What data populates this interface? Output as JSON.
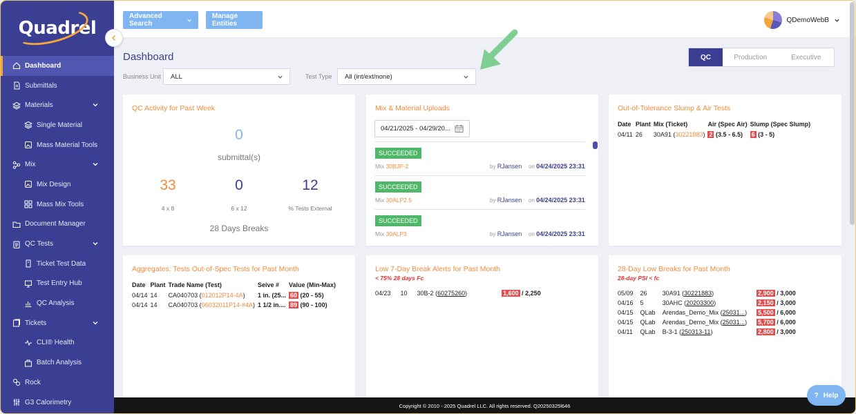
{
  "brand": {
    "logo_text": "Quadrel",
    "accent": "#f3a63a",
    "primary": "#3a3f94"
  },
  "sidebar": {
    "items": [
      {
        "label": "Dashboard",
        "icon": "home-icon",
        "active": true
      },
      {
        "label": "Submittals",
        "icon": "document-icon"
      },
      {
        "label": "Materials",
        "icon": "layers-icon",
        "expandable": true
      },
      {
        "label": "Single Material",
        "icon": "layers-icon",
        "sub": true
      },
      {
        "label": "Mass Material Tools",
        "icon": "image-icon",
        "sub": true
      },
      {
        "label": "Mix",
        "icon": "mix-icon",
        "expandable": true
      },
      {
        "label": "Mix Design",
        "icon": "image-icon",
        "sub": true
      },
      {
        "label": "Mass Mix Tools",
        "icon": "grid-icon",
        "sub": true
      },
      {
        "label": "Document Manager",
        "icon": "folder-icon"
      },
      {
        "label": "QC Tests",
        "icon": "clipboard-icon",
        "expandable": true
      },
      {
        "label": "Ticket Test Data",
        "icon": "ticket-icon",
        "sub": true
      },
      {
        "label": "Test Entry Hub",
        "icon": "monitor-icon",
        "sub": true
      },
      {
        "label": "QC Analysis",
        "icon": "chart-icon",
        "sub": true
      },
      {
        "label": "Tickets",
        "icon": "tickets-icon",
        "expandable": true
      },
      {
        "label": "CLI® Health",
        "icon": "health-icon",
        "sub": true
      },
      {
        "label": "Batch Analysis",
        "icon": "batch-icon",
        "sub": true
      },
      {
        "label": "Rock",
        "icon": "rock-icon"
      },
      {
        "label": "G3 Calorimetry",
        "icon": "sliders-icon"
      }
    ]
  },
  "topbar": {
    "advanced_search": "Advanced Search",
    "manage_entities": "Manage Entities",
    "username": "QDemoWebB"
  },
  "page": {
    "title": "Dashboard",
    "business_unit_label": "Business Unit",
    "business_unit_value": "ALL",
    "test_type_label": "Test Type",
    "test_type_value": "All (int/ext/none)",
    "views": [
      "QC",
      "Production",
      "Executive"
    ],
    "active_view": "QC"
  },
  "qc_activity": {
    "title": "QC Activity for Past Week",
    "submittals_count": "0",
    "submittals_label": "submittal(s)",
    "stats": [
      {
        "value": "33",
        "label": "4 x 8",
        "color": "#f28b3b"
      },
      {
        "value": "0",
        "label": "6 x 12",
        "color": "#3a3f94"
      },
      {
        "value": "12",
        "label": "% Tests External",
        "color": "#3a3f94"
      }
    ],
    "footer": "28 Days Breaks"
  },
  "uploads": {
    "title": "Mix & Material Uploads",
    "date_range": "04/21/2025 - 04/29/20...",
    "items": [
      {
        "status": "SUCCEEDED",
        "mix_prefix": "Mix",
        "mix": "30BJP-2",
        "by": "by",
        "user": "RJansen",
        "on": "on",
        "date": "04/24/2025 23:31"
      },
      {
        "status": "SUCCEEDED",
        "mix_prefix": "Mix",
        "mix": "30ALP2.5",
        "by": "by",
        "user": "RJansen",
        "on": "on",
        "date": "04/24/2025 23:31"
      },
      {
        "status": "SUCCEEDED",
        "mix_prefix": "Mix",
        "mix": "30ALP3",
        "by": "by",
        "user": "RJansen",
        "on": "on",
        "date": "04/24/2025 23:31"
      }
    ]
  },
  "tolerance": {
    "title": "Out-of-Tolerance Slump & Air Tests",
    "headers": [
      "Date",
      "Plant",
      "Mix (Ticket)",
      "Air (Spec Air)",
      "Slump (Spec Slump)"
    ],
    "rows": [
      {
        "date": "04/11",
        "plant": "26",
        "mix": "30A91",
        "ticket": "30221883",
        "air": "2",
        "air_spec": "(3.5 - 6.5)",
        "slump": "6",
        "slump_spec": "(3 - 5)"
      }
    ]
  },
  "aggregates": {
    "title": "Aggregates: Tests Out-of-Spec Tests for Past Month",
    "headers": [
      "Date",
      "Plant",
      "Trade Name (Test)",
      "Seive #",
      "Value (Min-Max)"
    ],
    "rows": [
      {
        "date": "04/14",
        "plant": "14",
        "name": "CA040703",
        "test": "012012P14-4A",
        "sieve": "1 in. (25...",
        "value": "60",
        "range": "(20 - 55)"
      },
      {
        "date": "04/14",
        "plant": "14",
        "name": "CA040703",
        "test": "06032011P14-#4A",
        "sieve": "1 1/2 in....",
        "value": "89",
        "range": "(90 - 100)"
      }
    ]
  },
  "low7": {
    "title": "Low 7-Day Break Alerts for Past Month",
    "subtitle": "< 75% 28 days Fc",
    "rows": [
      {
        "date": "04/23",
        "plant": "10",
        "mix": "30B-2",
        "ticket": "60275260",
        "value": "1,600",
        "spec": "/ 2,250"
      }
    ]
  },
  "low28": {
    "title": "28-Day Low Breaks for Past Month",
    "subtitle": "28-day PSI < fc",
    "rows": [
      {
        "date": "05/09",
        "plant": "26",
        "mix": "30A91",
        "ticket": "30221883",
        "value": "2,900",
        "spec": "/ 3,000"
      },
      {
        "date": "04/16",
        "plant": "5",
        "mix": "30AHC",
        "ticket": "20203300",
        "value": "2,150",
        "spec": "/ 3,000"
      },
      {
        "date": "04/15",
        "plant": "QLab",
        "mix": "Arendas_Demo_Mix",
        "ticket": "25031...",
        "value": "5,500",
        "spec": "/ 6,000"
      },
      {
        "date": "04/15",
        "plant": "QLab",
        "mix": "Arendas_Demo_Mix",
        "ticket": "25031...",
        "value": "5,700",
        "spec": "/ 6,000"
      },
      {
        "date": "04/11",
        "plant": "QLab",
        "mix": "B-3-1",
        "ticket": "250313-11",
        "value": "2,800",
        "spec": "/ 3,000"
      }
    ]
  },
  "footer": {
    "copyright": "Copyright © 2010 - 2025 Quadrel LLC. All rights reserved. Q20250325l646"
  },
  "help_label": "Help"
}
